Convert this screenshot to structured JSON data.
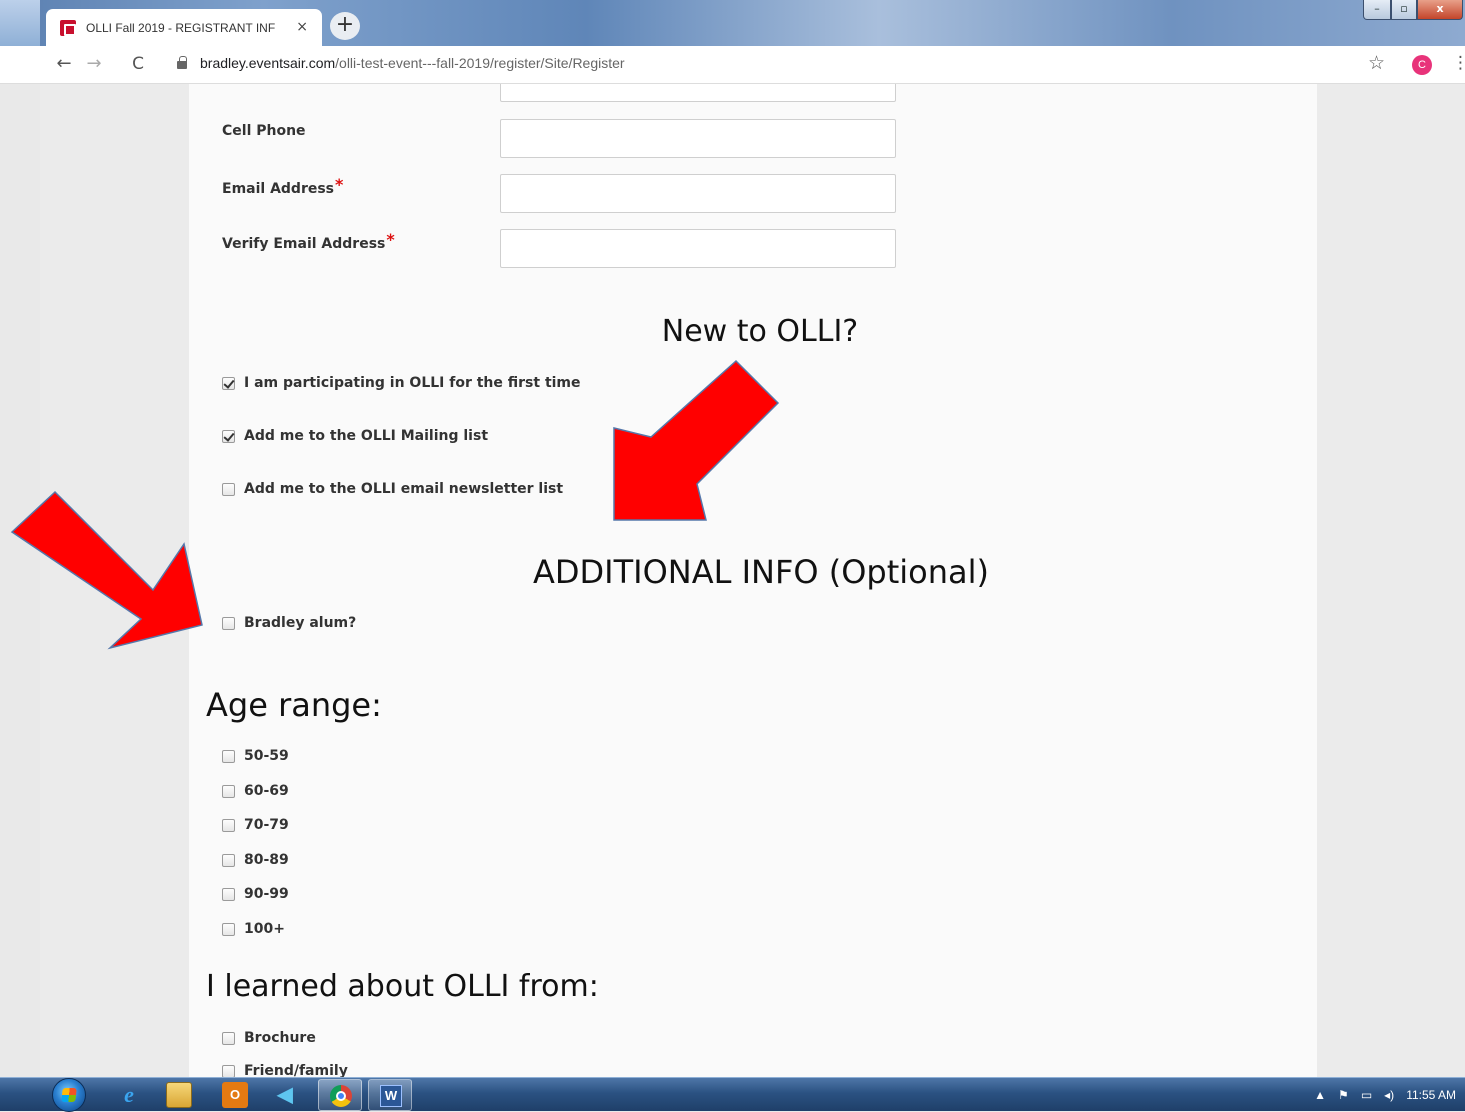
{
  "browser": {
    "tab_title": "OLLI Fall 2019 - REGISTRANT INF",
    "tab_close": "×",
    "new_tab": "+",
    "url_host": "bradley.eventsair.com",
    "url_path": "/olli-test-event---fall-2019/register/Site/Register",
    "profile_initial": "C",
    "icons": {
      "back": "←",
      "forward": "→",
      "reload": "C",
      "star": "☆",
      "menu": "⋮"
    },
    "window_controls": {
      "min": "–",
      "max": "▫",
      "close": "x"
    }
  },
  "form": {
    "fields": [
      {
        "label": "Cell Phone",
        "required": false,
        "value": ""
      },
      {
        "label": "Email Address",
        "required": true,
        "value": ""
      },
      {
        "label": "Verify Email Address",
        "required": true,
        "value": ""
      }
    ],
    "required_mark": "*",
    "new_to_olli": {
      "title": "New to OLLI?",
      "options": [
        {
          "label": "I am participating in OLLI for the first time",
          "checked": true
        },
        {
          "label": "Add me to the OLLI Mailing list",
          "checked": true
        },
        {
          "label": "Add me to the OLLI email newsletter list",
          "checked": false
        }
      ]
    },
    "additional_info": {
      "title": "ADDITIONAL INFO (Optional)",
      "options": [
        {
          "label": "Bradley alum?",
          "checked": false
        }
      ]
    },
    "age_range": {
      "title": "Age range:",
      "options": [
        {
          "label": "50-59",
          "checked": false
        },
        {
          "label": "60-69",
          "checked": false
        },
        {
          "label": "70-79",
          "checked": false
        },
        {
          "label": "80-89",
          "checked": false
        },
        {
          "label": "90-99",
          "checked": false
        },
        {
          "label": "100+",
          "checked": false
        }
      ]
    },
    "learned_from": {
      "title": "I learned about OLLI from:",
      "options": [
        {
          "label": "Brochure",
          "checked": false
        },
        {
          "label": "Friend/family",
          "checked": false
        }
      ]
    }
  },
  "annotation": {
    "arrow_color": "#ff0000"
  },
  "taskbar": {
    "outlook_glyph": "O",
    "word_glyph": "W",
    "ie_glyph": "e",
    "send_glyph": "◀",
    "tray_up": "▲",
    "tray_flag": "⚑",
    "tray_network": "▭",
    "tray_volume": "◂)",
    "clock": "11:55 AM"
  }
}
